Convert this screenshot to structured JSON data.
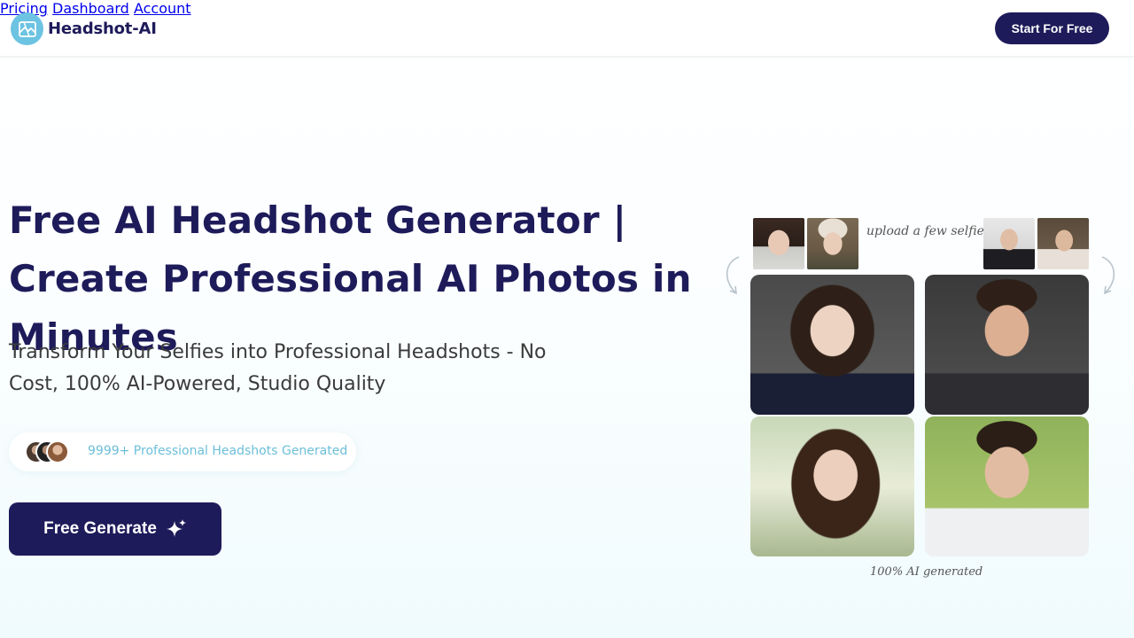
{
  "header": {
    "brand": "Headshot-AI",
    "nav": [
      {
        "label": "Pricing"
      },
      {
        "label": "Dashboard"
      },
      {
        "label": "Account"
      }
    ],
    "cta_label": "Start For Free"
  },
  "hero": {
    "title": "Free AI Headshot Generator | Create Professional AI Photos in Minutes",
    "subtitle": "Transform Your Selfies into Professional Headshots - No Cost, 100% AI-Powered, Studio Quality",
    "social_proof": "9999+ Professional Headshots Generated",
    "button_label": "Free Generate"
  },
  "gallery": {
    "upload_label": "upload a few selfies",
    "generated_label": "100% AI generated"
  },
  "colors": {
    "brand": "#1e1b5a",
    "accent": "#6cc3e2",
    "proof_text": "#6cbfd9"
  }
}
